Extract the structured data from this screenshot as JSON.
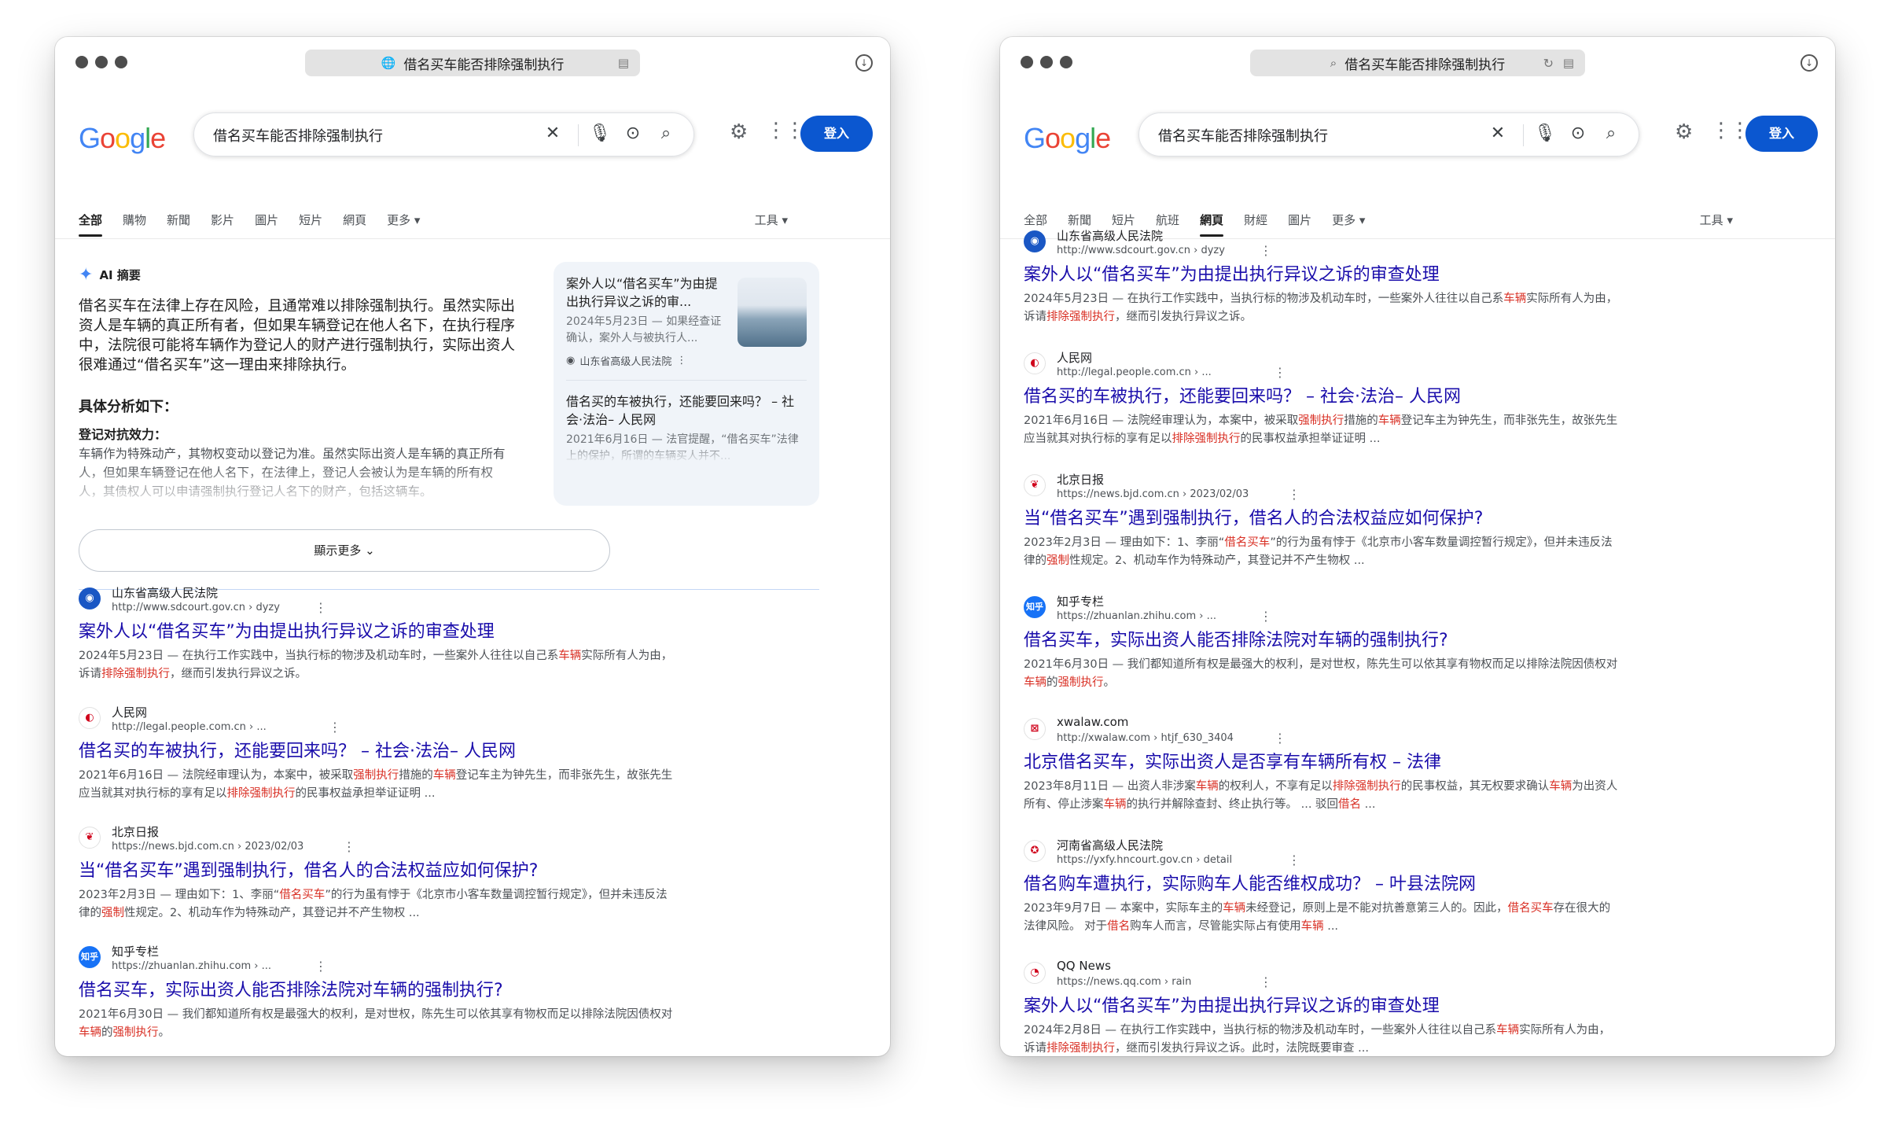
{
  "search": {
    "query": "借名买车能否排除强制执行",
    "address_text": "借名买车能否排除强制执行",
    "signin_label": "登入",
    "logo": [
      "G",
      "o",
      "o",
      "g",
      "l",
      "e"
    ]
  },
  "left": {
    "tabs": [
      "全部",
      "購物",
      "新聞",
      "影片",
      "圖片",
      "短片",
      "網頁",
      "更多"
    ],
    "active_tab": 0,
    "tools_label": "工具",
    "ai": {
      "label": "AI 摘要",
      "summary": "借名买车在法律上存在风险，且通常难以排除强制执行。虽然实际出资人是车辆的真正所有者，但如果车辆登记在他人名下，在执行程序中，法院很可能将车辆作为登记人的财产进行强制执行，实际出资人很难通过“借名买车”这一理由来排除执行。",
      "analysis_heading": "具体分析如下：",
      "point_heading": "登记对抗效力：",
      "point_text": "车辆作为特殊动产，其物权变动以登记为准。虽然实际出资人是车辆的真正所有人，但如果车辆登记在他人名下，在法律上，登记人会被认为是车辆的所有权人，其债权人可以申请强制执行登记人名下的财产，包括这辆车。",
      "card1_title": "案外人以“借名买车”为由提出执行异议之诉的审...",
      "card1_snip": "2024年5月23日 — 如果经查证确认，案外人与被执行人...",
      "card1_source": "山东省高级人民法院",
      "card2_title": "借名买的车被执行，还能要回来吗？ – 社会·法治– 人民网",
      "card2_snip": "2021年6月16日 — 法官提醒，“借名买车”法律上的保护，所谓的车辆买人并不...",
      "show_more": "顯示更多"
    },
    "results": [
      {
        "site": "山东省高级人民法院",
        "url": "http://www.sdcourt.gov.cn › dyzy",
        "title": "案外人以“借名买车”为由提出执行异议之诉的审查处理",
        "snippet": "2024年5月23日 — 在执行工作实践中，当执行标的物涉及机动车时，一些案外人往往以自己系车辆实际所有人为由，诉请排除强制执行，继而引发执行异议之诉。",
        "fav": "◉"
      },
      {
        "site": "人民网",
        "url": "http://legal.people.com.cn › ...",
        "title": "借名买的车被执行，还能要回来吗？ – 社会·法治– 人民网",
        "snippet": "2021年6月16日 — 法院经审理认为，本案中，被采取强制执行措施的车辆登记车主为钟先生，而非张先生，故张先生应当就其对执行标的享有足以排除强制执行的民事权益承担举证证明 ...",
        "fav": "◐"
      },
      {
        "site": "北京日报",
        "url": "https://news.bjd.com.cn › 2023/02/03",
        "title": "当“借名买车”遇到强制执行，借名人的合法权益应如何保护?",
        "snippet": "2023年2月3日 — 理由如下：1、李丽“借名买车”的行为虽有悖于《北京市小客车数量调控暂行规定》，但并未违反法律的强制性规定。2、机动车作为特殊动产，其登记并不产生物权 ...",
        "fav": "❦"
      },
      {
        "site": "知乎专栏",
        "url": "https://zhuanlan.zhihu.com › ...",
        "title": "借名买车，实际出资人能否排除法院对车辆的强制执行?",
        "snippet": "2021年6月30日 — 我们都知道所有权是最强大的权利，是对世权，陈先生可以依其享有物权而足以排除法院因债权对车辆的强制执行。",
        "fav": "知乎"
      }
    ]
  },
  "right": {
    "tabs": [
      "全部",
      "新聞",
      "短片",
      "航班",
      "網頁",
      "財經",
      "圖片",
      "更多"
    ],
    "active_tab": 4,
    "tools_label": "工具",
    "results": [
      {
        "site": "山东省高级人民法院",
        "url": "http://www.sdcourt.gov.cn › dyzy",
        "title": "案外人以“借名买车”为由提出执行异议之诉的审查处理",
        "snippet": "2024年5月23日 — 在执行工作实践中，当执行标的物涉及机动车时，一些案外人往往以自己系车辆实际所有人为由，诉请排除强制执行，继而引发执行异议之诉。",
        "fav": "◉"
      },
      {
        "site": "人民网",
        "url": "http://legal.people.com.cn › ...",
        "title": "借名买的车被执行，还能要回来吗？ – 社会·法治– 人民网",
        "snippet": "2021年6月16日 — 法院经审理认为，本案中，被采取强制执行措施的车辆登记车主为钟先生，而非张先生，故张先生应当就其对执行标的享有足以排除强制执行的民事权益承担举证证明 ...",
        "fav": "◐"
      },
      {
        "site": "北京日报",
        "url": "https://news.bjd.com.cn › 2023/02/03",
        "title": "当“借名买车”遇到强制执行，借名人的合法权益应如何保护?",
        "snippet": "2023年2月3日 — 理由如下：1、李丽“借名买车”的行为虽有悖于《北京市小客车数量调控暂行规定》，但并未违反法律的强制性规定。2、机动车作为特殊动产，其登记并不产生物权 ...",
        "fav": "❦"
      },
      {
        "site": "知乎专栏",
        "url": "https://zhuanlan.zhihu.com › ...",
        "title": "借名买车，实际出资人能否排除法院对车辆的强制执行?",
        "snippet": "2021年6月30日 — 我们都知道所有权是最强大的权利，是对世权，陈先生可以依其享有物权而足以排除法院因债权对车辆的强制执行。",
        "fav": "知乎"
      },
      {
        "site": "xwalaw.com",
        "url": "http://xwalaw.com › htjf_630_3404",
        "title": "北京借名买车，实际出资人是否享有车辆所有权 – 法律",
        "snippet": "2023年8月11日 — 出资人非涉案车辆的权利人，不享有足以排除强制执行的民事权益，其无权要求确认车辆为出资人所有、停止涉案车辆的执行并解除查封、终止执行等。 ... 驳回借名 ...",
        "fav": "⊠"
      },
      {
        "site": "河南省高级人民法院",
        "url": "https://yxfy.hncourt.gov.cn › detail",
        "title": "借名购车遭执行，实际购车人能否维权成功？ – 叶县法院网",
        "snippet": "2023年9月7日 — 本案中，实际车主的车辆未经登记，原则上是不能对抗善意第三人的。因此，借名买车存在很大的法律风险。 对于借名购车人而言，尽管能实际占有使用车辆 ...",
        "fav": "✪"
      },
      {
        "site": "QQ News",
        "url": "https://news.qq.com › rain",
        "title": "案外人以“借名买车”为由提出执行异议之诉的审查处理",
        "snippet": "2024年2月8日 — 在执行工作实践中，当执行标的物涉及机动车时，一些案外人往往以自己系车辆实际所有人为由，诉请排除强制执行，继而引发执行异议之诉。此时，法院既要审查 ...",
        "fav": "◔"
      }
    ]
  },
  "icons": {
    "globe": "globe-icon",
    "search": "search-icon",
    "clear": "close-icon",
    "mic": "microphone-icon",
    "lens": "lens-icon",
    "gear": "gear-icon",
    "apps": "apps-grid-icon",
    "download": "download-icon",
    "reload": "reload-icon",
    "reader": "reader-icon",
    "more": "more-vert-icon"
  },
  "colors": {
    "link": "#1a0dab",
    "signin": "#0b57d0",
    "highlight": "#d93025"
  }
}
